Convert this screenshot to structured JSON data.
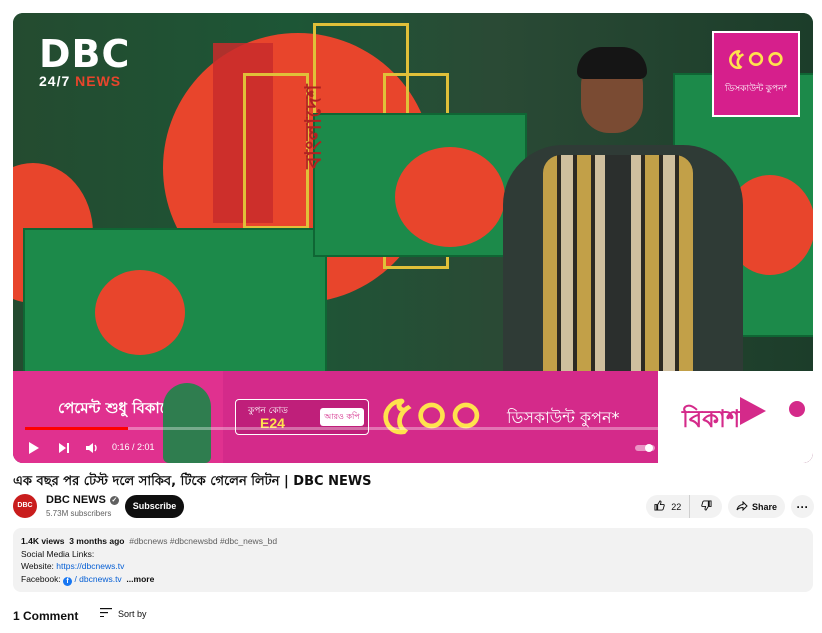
{
  "player": {
    "channel_logo_big": "DBC",
    "channel_logo_small_a": "24/7 ",
    "channel_logo_small_b": "NEWS",
    "promo_badge_number": "৫০০",
    "promo_badge_text": "ডিসকাউন্ট কুপন*",
    "ad": {
      "payment_text": "পেমেন্ট শুধু বিকাশে",
      "coupon_label": "কুপন কোড",
      "coupon_code": "E24",
      "coupon_button": "আরও কপি",
      "amount": "৫০০",
      "discount_text": "ডিসকাউন্ট কুপন*",
      "brand": "বিকাশ"
    },
    "time_current": "0:16",
    "time_total": "2:01",
    "time_display": "0:16 / 2:01",
    "progress_fraction": 0.133,
    "controls": [
      "play-icon",
      "next-icon",
      "volume-icon",
      "autoplay-toggle",
      "subtitles-icon",
      "settings-icon",
      "miniplayer-icon",
      "theater-icon",
      "fullscreen-icon"
    ]
  },
  "video": {
    "title": "এক বছর পর টেস্ট দলে সাকিব, টিকে গেলেন লিটন | DBC NEWS"
  },
  "channel": {
    "avatar_text": "DBC",
    "name": "DBC NEWS",
    "subscribers": "5.73M subscribers",
    "subscribe_label": "Subscribe"
  },
  "actions": {
    "like_count": "22",
    "share_label": "Share",
    "more_label": "···"
  },
  "description": {
    "views": "1.4K views",
    "age": "3 months ago",
    "hashtags": "#dbcnews #dbcnewsbd #dbc_news_bd",
    "line2": "Social Media Links:",
    "website_label": "Website: ",
    "website_url": "https://dbcnews.tv",
    "facebook_label": "Facebook: ",
    "facebook_text": "/ dbcnews.tv",
    "more": "...more"
  },
  "comments": {
    "count_label": "1 Comment",
    "sort_label": "Sort by"
  },
  "colors": {
    "brand_red": "#ff0000",
    "bkash_pink": "#d42a8a",
    "link_blue": "#065fd4"
  }
}
